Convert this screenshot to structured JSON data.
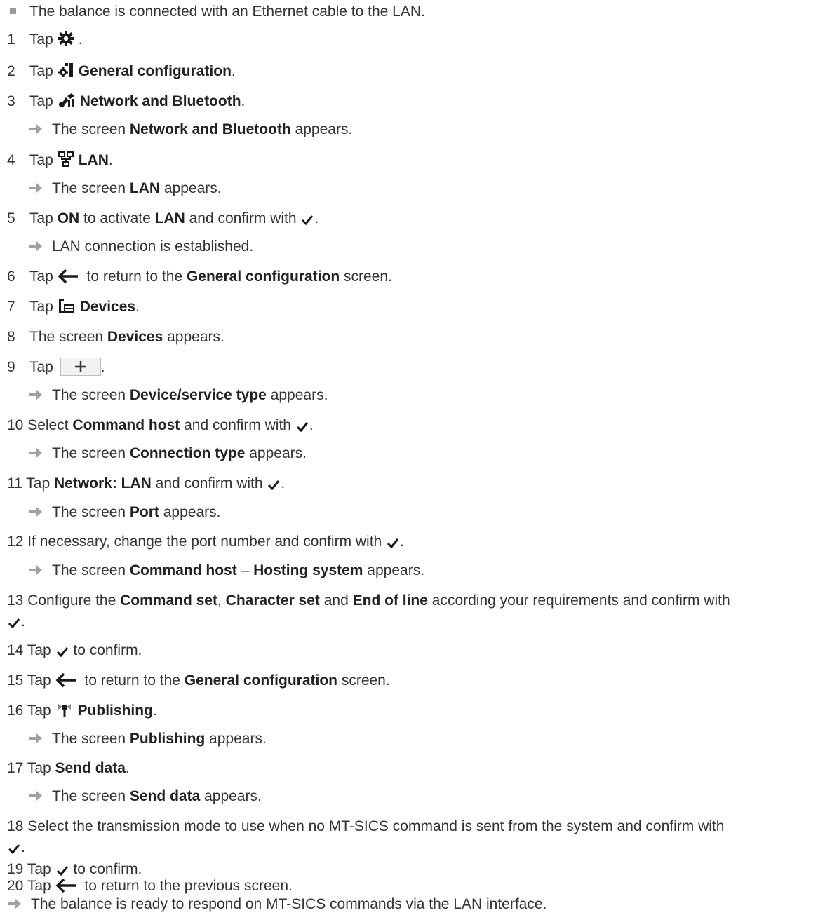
{
  "precondition": "The balance is connected with an Ethernet cable to the LAN.",
  "steps": [
    {
      "n": "1",
      "a": "Tap ",
      "b": "",
      "c": "."
    },
    {
      "n": "2",
      "a": "Tap ",
      "b": "General configuration",
      "c": "."
    },
    {
      "n": "3",
      "a": "Tap ",
      "b": "Network and Bluetooth",
      "c": "."
    },
    {
      "n": "4",
      "a": "Tap ",
      "b": "LAN",
      "c": "."
    },
    {
      "n": "5",
      "a": "Tap ",
      "b": "ON",
      "c": " to activate ",
      "d": "LAN",
      "e": " and confirm with ",
      "f": "."
    },
    {
      "n": "6",
      "a": "Tap ",
      "b": " to return to the ",
      "c": "General configuration",
      "d": " screen."
    },
    {
      "n": "7",
      "a": "Tap ",
      "b": "Devices",
      "c": "."
    },
    {
      "n": "8",
      "a": "The screen ",
      "b": "Devices",
      "c": " appears."
    },
    {
      "n": "9",
      "a": "Tap ",
      "b": "."
    },
    {
      "n": "10",
      "a": "Select ",
      "b": "Command host",
      "c": " and confirm with ",
      "d": "."
    },
    {
      "n": "11",
      "a": "Tap ",
      "b": "Network: LAN",
      "c": " and confirm with ",
      "d": "."
    },
    {
      "n": "12",
      "a": "If necessary, change the port number and confirm with ",
      "b": "."
    },
    {
      "n": "13",
      "a": "Configure the ",
      "b": "Command set",
      "c": ", ",
      "d": "Character set",
      "e": " and ",
      "f": "End of line",
      "g": " according your requirements and confirm with",
      "h": "."
    },
    {
      "n": "14",
      "a": "Tap ",
      "b": " to confirm."
    },
    {
      "n": "15",
      "a": "Tap ",
      "b": " to return to the ",
      "c": "General configuration",
      "d": " screen."
    },
    {
      "n": "16",
      "a": "Tap ",
      "b": "Publishing",
      "c": "."
    },
    {
      "n": "17",
      "a": "Tap ",
      "b": "Send data",
      "c": "."
    },
    {
      "n": "18",
      "a": "Select the transmission mode to use when no MT-SICS command is sent from the system and confirm with",
      "b": "."
    },
    {
      "n": "19",
      "a": "Tap ",
      "b": " to confirm."
    },
    {
      "n": "20",
      "a": "Tap ",
      "b": " to return to the previous screen."
    }
  ],
  "results": {
    "r3": {
      "a": "The screen ",
      "b": "Network and Bluetooth",
      "c": " appears."
    },
    "r4": {
      "a": "The screen ",
      "b": "LAN",
      "c": " appears."
    },
    "r5": {
      "a": "LAN connection is established."
    },
    "r9": {
      "a": "The screen ",
      "b": "Device/service type",
      "c": " appears."
    },
    "r10": {
      "a": "The screen ",
      "b": "Connection type",
      "c": " appears."
    },
    "r11": {
      "a": "The screen ",
      "b": "Port",
      "c": " appears."
    },
    "r12": {
      "a": "The screen ",
      "b": "Command host",
      "c": " – ",
      "d": "Hosting system",
      "e": " appears."
    },
    "r16": {
      "a": "The screen ",
      "b": "Publishing",
      "c": " appears."
    },
    "r17": {
      "a": "The screen ",
      "b": "Send data",
      "c": " appears."
    }
  },
  "final_result": "The balance is ready to respond on MT-SICS commands via the LAN interface.",
  "icons": {
    "settings": "gear-icon",
    "general": "general-configuration-icon",
    "network": "network-bluetooth-icon",
    "lan": "lan-icon",
    "devices": "devices-icon",
    "publishing": "publishing-icon",
    "back": "arrow-left-icon",
    "confirm": "checkmark-icon",
    "add": "plus-button"
  },
  "colors": {
    "text": "#333333",
    "bold": "#222222",
    "bullet": "#9a9a9a",
    "arrow": "#a0a0a0"
  }
}
